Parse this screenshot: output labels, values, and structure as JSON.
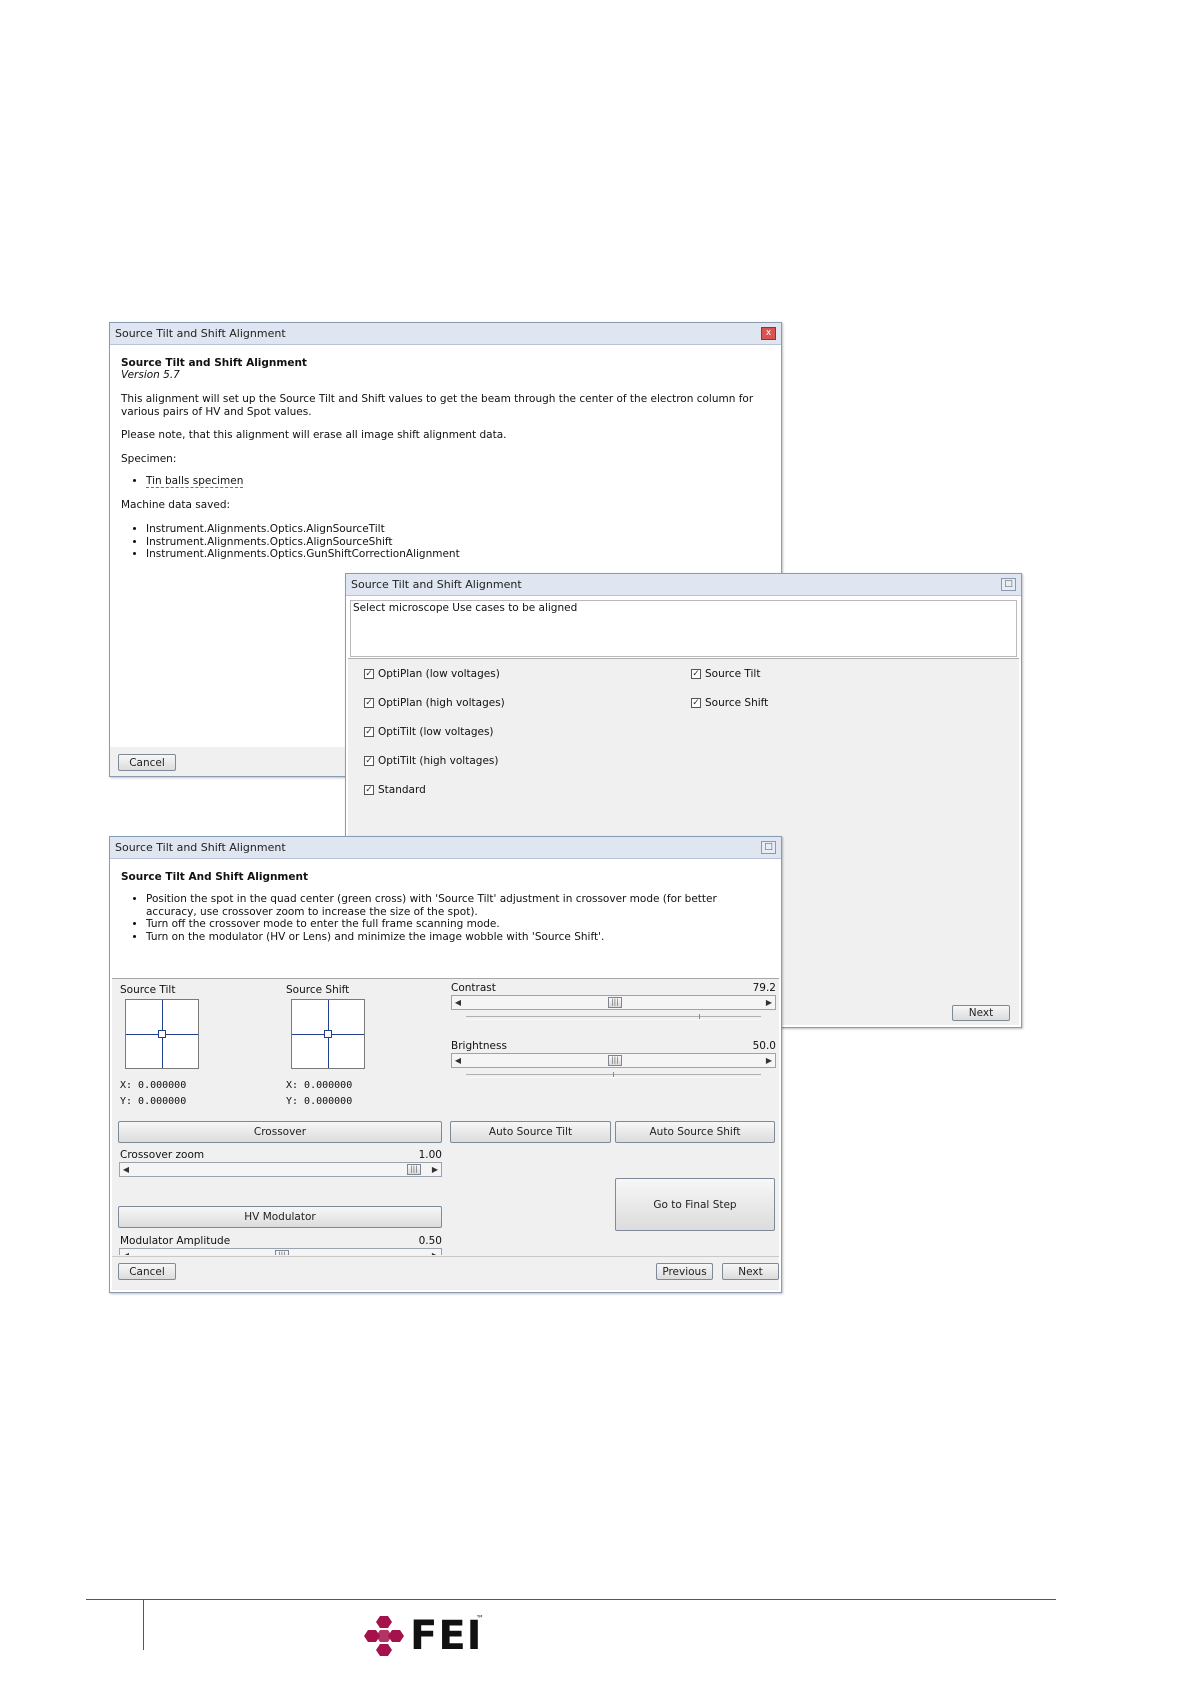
{
  "window1": {
    "title": "Source Tilt and Shift Alignment",
    "heading": "Source Tilt and Shift Alignment",
    "version": "Version 5.7",
    "description": "This alignment will set up the Source Tilt and Shift values to get the beam through the center of the electron column for various pairs of HV and Spot values.",
    "note": "Please note, that this alignment will erase all image shift alignment data.",
    "specimen_label": "Specimen:",
    "specimen_items": [
      "Tin balls specimen"
    ],
    "machine_label": "Machine data saved:",
    "machine_items": [
      "Instrument.Alignments.Optics.AlignSourceTilt",
      "Instrument.Alignments.Optics.AlignSourceShift",
      "Instrument.Alignments.Optics.GunShiftCorrectionAlignment"
    ],
    "cancel_label": "Cancel",
    "close_glyph": "x"
  },
  "window2": {
    "title": "Source Tilt and Shift Alignment",
    "instruction": "Select microscope Use cases to be aligned",
    "left_options": [
      {
        "label": "OptiPlan (low voltages)",
        "checked": true
      },
      {
        "label": "OptiPlan (high voltages)",
        "checked": true
      },
      {
        "label": "OptiTilt (low voltages)",
        "checked": true
      },
      {
        "label": "OptiTilt (high voltages)",
        "checked": true
      },
      {
        "label": "Standard",
        "checked": true
      }
    ],
    "right_options": [
      {
        "label": "Source Tilt",
        "checked": true
      },
      {
        "label": "Source Shift",
        "checked": true
      }
    ],
    "next_label": "Next"
  },
  "window3": {
    "title": "Source Tilt and Shift Alignment",
    "heading": "Source Tilt And Shift Alignment",
    "steps": [
      "Position the spot in the quad center (green cross) with 'Source Tilt' adjustment in crossover mode (for better accuracy, use crossover zoom to increase the size of the spot).",
      "Turn off the crossover mode to enter the full frame scanning mode.",
      "Turn on the modulator (HV or Lens) and minimize the image wobble with 'Source Shift'."
    ],
    "source_tilt": {
      "label": "Source Tilt",
      "x": "X: 0.000000",
      "y": "Y: 0.000000"
    },
    "source_shift": {
      "label": "Source Shift",
      "x": "X: 0.000000",
      "y": "Y: 0.000000"
    },
    "contrast": {
      "label": "Contrast",
      "value": "79.2"
    },
    "brightness": {
      "label": "Brightness",
      "value": "50.0"
    },
    "crossover_label": "Crossover",
    "auto_tilt_label": "Auto Source Tilt",
    "auto_shift_label": "Auto Source Shift",
    "crossover_zoom": {
      "label": "Crossover zoom",
      "value": "1.00"
    },
    "final_step_label": "Go to Final Step",
    "hv_modulator_label": "HV Modulator",
    "modulator_amplitude": {
      "label": "Modulator Amplitude",
      "value": "0.50"
    },
    "cancel_label": "Cancel",
    "previous_label": "Previous",
    "next_label": "Next"
  },
  "footer": {
    "logo_text": "FEI",
    "trademark": "™",
    "rule_color": "#a0325a",
    "logo_color": "#a5114a"
  }
}
